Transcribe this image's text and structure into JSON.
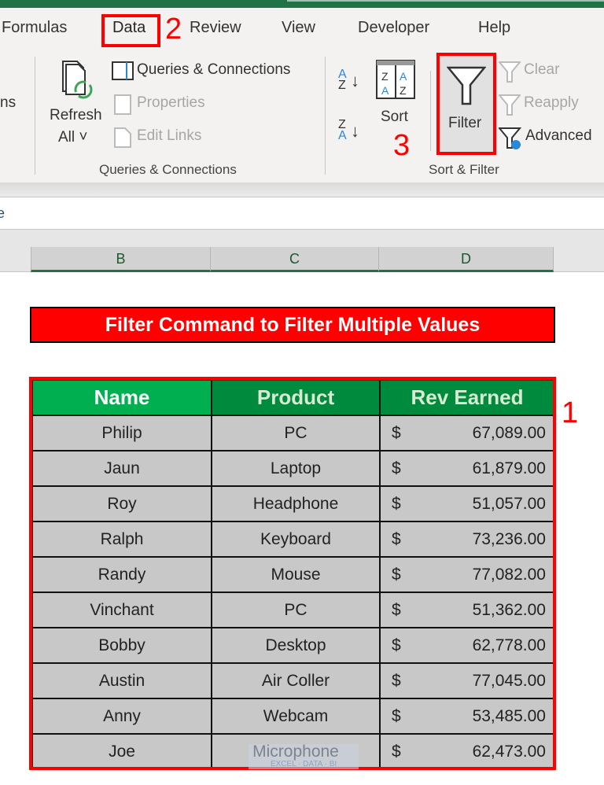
{
  "ribbon": {
    "tabs": [
      "Formulas",
      "Data",
      "Review",
      "View",
      "Developer",
      "Help"
    ],
    "active_tab": "Data",
    "partial_left_label": "ns",
    "queries_group": {
      "refresh_all": [
        "Refresh",
        "All ˅"
      ],
      "queries_connections": "Queries & Connections",
      "properties": "Properties",
      "edit_links": "Edit Links",
      "label": "Queries & Connections"
    },
    "sort_filter_group": {
      "sort": "Sort",
      "filter": "Filter",
      "clear": "Clear",
      "reapply": "Reapply",
      "advanced": "Advanced",
      "label": "Sort & Filter"
    }
  },
  "steps": {
    "one": "1",
    "two": "2",
    "three": "3"
  },
  "formula_bar": {
    "fragment": "e"
  },
  "columns": [
    "B",
    "C",
    "D"
  ],
  "sheet": {
    "title": "Filter Command to Filter Multiple Values",
    "headers": [
      "Name",
      "Product",
      "Rev Earned"
    ],
    "rows": [
      {
        "name": "Philip",
        "product": "PC",
        "currency": "$",
        "rev": "67,089.00"
      },
      {
        "name": "Jaun",
        "product": "Laptop",
        "currency": "$",
        "rev": "61,879.00"
      },
      {
        "name": "Roy",
        "product": "Headphone",
        "currency": "$",
        "rev": "51,057.00"
      },
      {
        "name": "Ralph",
        "product": "Keyboard",
        "currency": "$",
        "rev": "73,236.00"
      },
      {
        "name": "Randy",
        "product": "Mouse",
        "currency": "$",
        "rev": "77,082.00"
      },
      {
        "name": "Vinchant",
        "product": "PC",
        "currency": "$",
        "rev": "51,362.00"
      },
      {
        "name": "Bobby",
        "product": "Desktop",
        "currency": "$",
        "rev": "62,778.00"
      },
      {
        "name": "Austin",
        "product": "Air Coller",
        "currency": "$",
        "rev": "77,045.00"
      },
      {
        "name": "Anny",
        "product": "Webcam",
        "currency": "$",
        "rev": "53,485.00"
      },
      {
        "name": "Joe",
        "product": "Microphone",
        "currency": "$",
        "rev": "62,473.00"
      }
    ]
  },
  "watermark": "EXCEL · DATA · BI"
}
